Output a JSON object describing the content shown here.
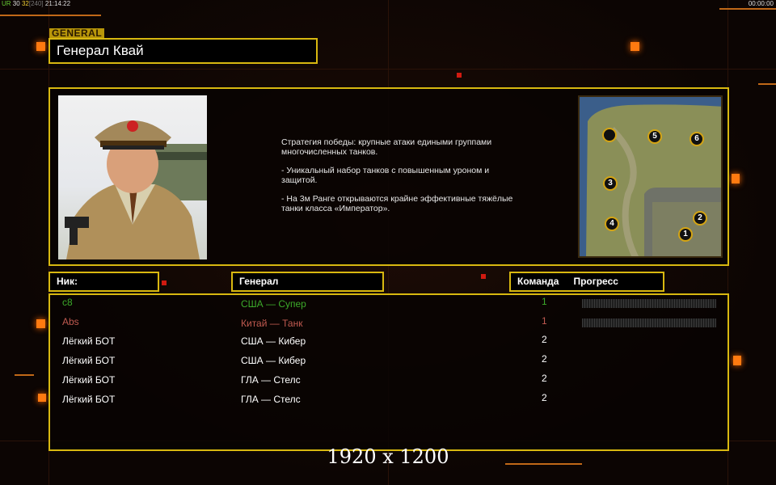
{
  "hud": {
    "left_a": "UR",
    "left_b": "30",
    "left_c": "32",
    "left_d": "[240]",
    "left_time": "21:14:22",
    "right_time": "00:00:00"
  },
  "general_label": "GENERAL",
  "general_name": "Генерал Квай",
  "description": [
    "Стратегия победы: крупные атаки едиными группами многочисленных танков.",
    "- Уникальный набор танков с повышенным уроном и защитой.",
    "- На 3м Ранге открываются крайне эффективные тяжёлые танки класса «Император»."
  ],
  "map": {
    "markers": [
      "",
      "5",
      "6",
      "3",
      "4",
      "2",
      "1"
    ]
  },
  "columns": {
    "nick": "Ник:",
    "general": "Генерал",
    "team": "Команда",
    "progress": "Прогресс"
  },
  "players": [
    {
      "nick": "c8",
      "general": "США — Супер",
      "team": "1",
      "progress": 0,
      "color": "#3caa2a"
    },
    {
      "nick": "Abs",
      "general": "Китай — Танк",
      "team": "1",
      "progress": 0,
      "color": "#c05a50"
    },
    {
      "nick": "Лёгкий БОТ",
      "general": "США — Кибер",
      "team": "2",
      "color": "#ffffff"
    },
    {
      "nick": "Лёгкий БОТ",
      "general": "США — Кибер",
      "team": "2",
      "color": "#ffffff"
    },
    {
      "nick": "Лёгкий БОТ",
      "general": "ГЛА — Стелс",
      "team": "2",
      "color": "#ffffff"
    },
    {
      "nick": "Лёгкий БОТ",
      "general": "ГЛА — Стелс",
      "team": "2",
      "color": "#ffffff"
    }
  ],
  "resolution": "1920 x 1200"
}
